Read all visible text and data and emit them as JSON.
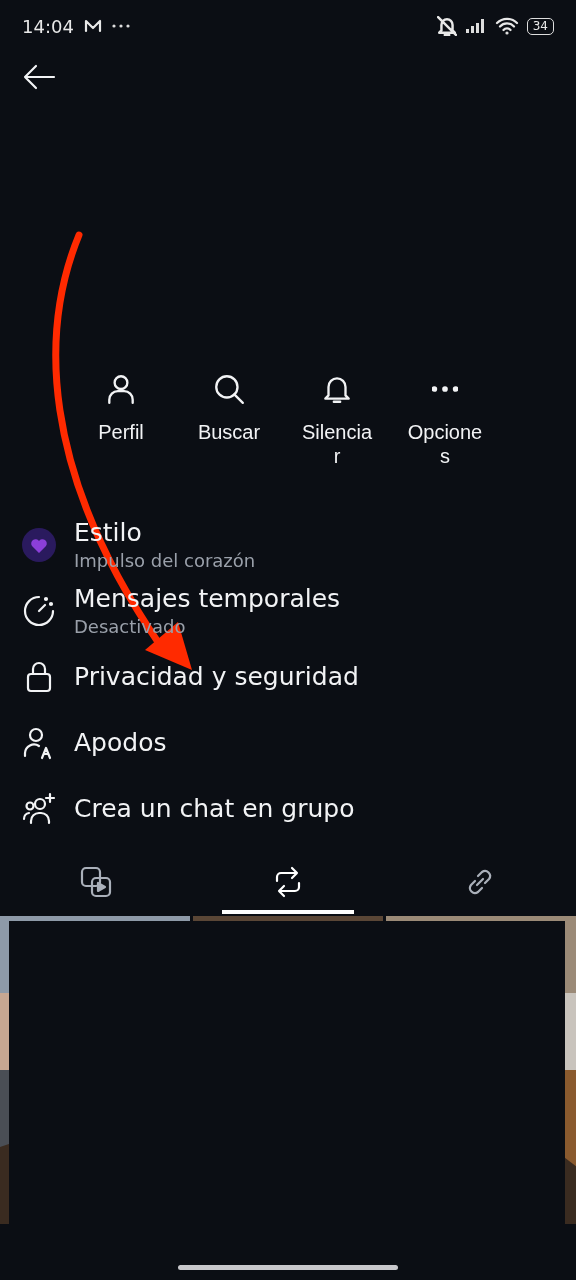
{
  "status_bar": {
    "time": "14:04",
    "battery": "34"
  },
  "actions": [
    {
      "kind": "profile",
      "label": "Perfil"
    },
    {
      "kind": "search",
      "label": "Buscar"
    },
    {
      "kind": "mute",
      "label": "Silenciar"
    },
    {
      "kind": "options",
      "label": "Opciones"
    }
  ],
  "menu": [
    {
      "kind": "style",
      "title": "Estilo",
      "subtitle": "Impulso del corazón"
    },
    {
      "kind": "timer",
      "title": "Mensajes temporales",
      "subtitle": "Desactivado"
    },
    {
      "kind": "lock",
      "title": "Privacidad y seguridad"
    },
    {
      "kind": "nickname",
      "title": "Apodos"
    },
    {
      "kind": "group",
      "title": "Crea un chat en grupo"
    }
  ],
  "tabs": [
    {
      "kind": "media",
      "selected": false
    },
    {
      "kind": "reposts",
      "selected": true
    },
    {
      "kind": "links",
      "selected": false
    }
  ]
}
